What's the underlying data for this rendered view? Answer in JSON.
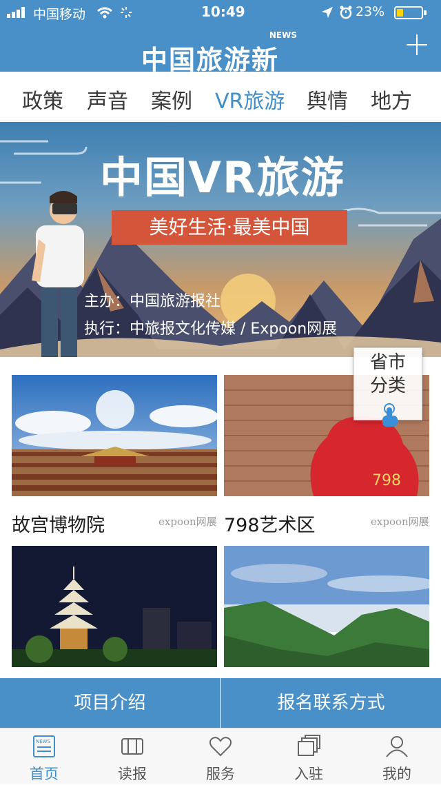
{
  "status_bar": {
    "carrier": "中国移动",
    "time": "10:49",
    "battery": "23%"
  },
  "header": {
    "logo_text": "中国旅游新闻",
    "logo_news_word": "NEWS",
    "add_icon": "plus-icon"
  },
  "channels": [
    {
      "label": "政策",
      "active": false
    },
    {
      "label": "声音",
      "active": false
    },
    {
      "label": "案例",
      "active": false
    },
    {
      "label": "VR旅游",
      "active": true
    },
    {
      "label": "舆情",
      "active": false
    },
    {
      "label": "地方",
      "active": false
    }
  ],
  "banner": {
    "title": "中国VR旅游",
    "ribbon": "美好生活·最美中国",
    "organizer": "主办：中国旅游报社",
    "executor": "执行：中旅报文化传媒 / Expoon网展"
  },
  "cards": [
    {
      "title": "故宫博物院",
      "source": "expoon网展"
    },
    {
      "title": "798艺术区",
      "source": "expoon网展"
    },
    {
      "title": "",
      "source": ""
    },
    {
      "title": "",
      "source": ""
    }
  ],
  "province_widget": {
    "line1": "省市",
    "line2": "分类"
  },
  "action_bar": {
    "left": "项目介绍",
    "right": "报名联系方式"
  },
  "tab_bar": [
    {
      "label": "首页",
      "icon": "news-icon",
      "active": true
    },
    {
      "label": "读报",
      "icon": "newspaper-icon",
      "active": false
    },
    {
      "label": "服务",
      "icon": "heart-icon",
      "active": false
    },
    {
      "label": "入驻",
      "icon": "stack-icon",
      "active": false
    },
    {
      "label": "我的",
      "icon": "user-icon",
      "active": false
    }
  ],
  "colors": {
    "brand_blue": "#4a90c8",
    "active_tab": "#3f8fca",
    "ribbon_red": "#d4553a"
  }
}
